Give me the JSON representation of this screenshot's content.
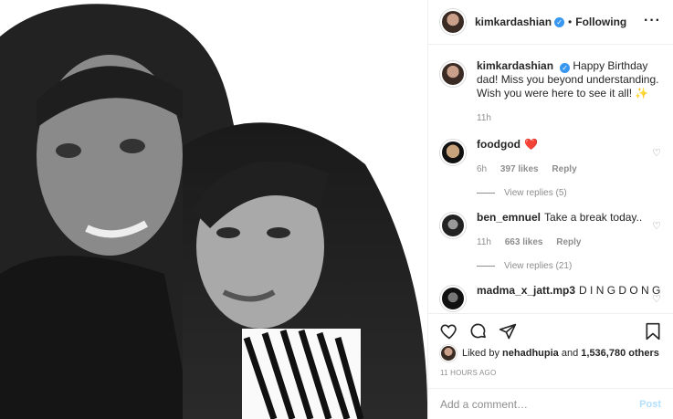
{
  "post": {
    "photo_alt": "",
    "author": "kimkardashian",
    "follow_status": "Following",
    "dot_separator": "•"
  },
  "caption": {
    "username": "kimkardashian",
    "text": "Happy Birthday dad! Miss you beyond understanding. Wish you were here to see it all! ✨",
    "time": "11h"
  },
  "comments": [
    {
      "username": "foodgod",
      "text": "❤️",
      "time": "6h",
      "likes": "397 likes",
      "reply": "Reply",
      "view_replies": "View replies (5)"
    },
    {
      "username": "ben_emnuel",
      "text": "Take a break today..",
      "time": "11h",
      "likes": "663 likes",
      "reply": "Reply",
      "view_replies": "View replies (21)"
    },
    {
      "username": "madma_x_jatt.mp3",
      "text": "D I N G D O N G"
    }
  ],
  "likes": {
    "prefix": "Liked by",
    "user": "nehadhupia",
    "suffix": "and",
    "count": "1,536,780 others"
  },
  "timestamp": "11 HOURS AGO",
  "add_comment": {
    "placeholder": "Add a comment…",
    "post_label": "Post"
  },
  "colors": {
    "verified": "#3897f0",
    "heart": "#ed4956",
    "post_disabled": "#b2dffc",
    "meta": "#8e8e8e"
  }
}
